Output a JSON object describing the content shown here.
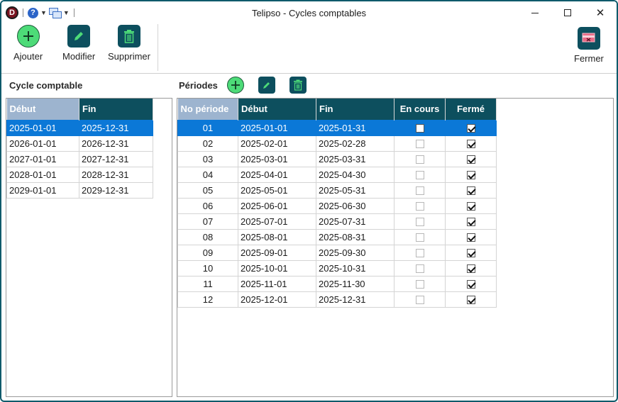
{
  "window": {
    "title": "Telipso - Cycles comptables",
    "logo_letter": "D",
    "help_glyph": "?",
    "close_glyph": "✕"
  },
  "icons": {
    "app": "app-logo-icon",
    "help": "help-icon",
    "windows": "windows-icon",
    "add": "plus-icon",
    "edit": "pencil-icon",
    "delete": "trash-icon",
    "close_app": "exit-icon"
  },
  "colors": {
    "accent_dark": "#0d4f5e",
    "add_green": "#4ddb78",
    "selection": "#0b78d7",
    "sorted_header": "#9db4cf"
  },
  "toolbar": {
    "add_label": "Ajouter",
    "edit_label": "Modifier",
    "delete_label": "Supprimer",
    "close_label": "Fermer"
  },
  "cycles": {
    "title": "Cycle comptable",
    "columns": [
      "Début",
      "Fin"
    ],
    "rows": [
      {
        "start": "2025-01-01",
        "end": "2025-12-31",
        "selected": true
      },
      {
        "start": "2026-01-01",
        "end": "2026-12-31",
        "selected": false
      },
      {
        "start": "2027-01-01",
        "end": "2027-12-31",
        "selected": false
      },
      {
        "start": "2028-01-01",
        "end": "2028-12-31",
        "selected": false
      },
      {
        "start": "2029-01-01",
        "end": "2029-12-31",
        "selected": false
      }
    ]
  },
  "periods": {
    "title": "Périodes",
    "columns": [
      "No période",
      "Début",
      "Fin",
      "En cours",
      "Fermé"
    ],
    "rows": [
      {
        "no": "01",
        "start": "2025-01-01",
        "end": "2025-01-31",
        "current": false,
        "closed": true,
        "selected": true
      },
      {
        "no": "02",
        "start": "2025-02-01",
        "end": "2025-02-28",
        "current": false,
        "closed": true,
        "selected": false
      },
      {
        "no": "03",
        "start": "2025-03-01",
        "end": "2025-03-31",
        "current": false,
        "closed": true,
        "selected": false
      },
      {
        "no": "04",
        "start": "2025-04-01",
        "end": "2025-04-30",
        "current": false,
        "closed": true,
        "selected": false
      },
      {
        "no": "05",
        "start": "2025-05-01",
        "end": "2025-05-31",
        "current": false,
        "closed": true,
        "selected": false
      },
      {
        "no": "06",
        "start": "2025-06-01",
        "end": "2025-06-30",
        "current": false,
        "closed": true,
        "selected": false
      },
      {
        "no": "07",
        "start": "2025-07-01",
        "end": "2025-07-31",
        "current": false,
        "closed": true,
        "selected": false
      },
      {
        "no": "08",
        "start": "2025-08-01",
        "end": "2025-08-31",
        "current": false,
        "closed": true,
        "selected": false
      },
      {
        "no": "09",
        "start": "2025-09-01",
        "end": "2025-09-30",
        "current": false,
        "closed": true,
        "selected": false
      },
      {
        "no": "10",
        "start": "2025-10-01",
        "end": "2025-10-31",
        "current": false,
        "closed": true,
        "selected": false
      },
      {
        "no": "11",
        "start": "2025-11-01",
        "end": "2025-11-30",
        "current": false,
        "closed": true,
        "selected": false
      },
      {
        "no": "12",
        "start": "2025-12-01",
        "end": "2025-12-31",
        "current": false,
        "closed": true,
        "selected": false
      }
    ]
  }
}
